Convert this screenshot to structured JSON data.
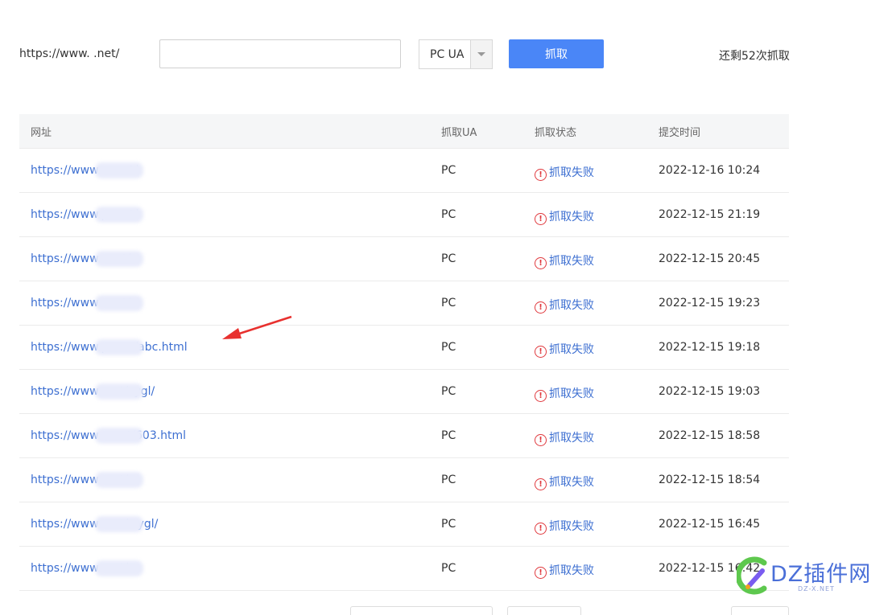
{
  "toolbar": {
    "url_prefix": "https://www.          .net/",
    "url_input_value": "",
    "ua_selected": "PC UA",
    "fetch_label": "抓取",
    "remaining_text": "还剩52次抓取"
  },
  "table": {
    "headers": {
      "url": "网址",
      "ua": "抓取UA",
      "status": "抓取状态",
      "time": "提交时间"
    },
    "rows": [
      {
        "url": "https://www.          n.net/",
        "ua": "PC",
        "status": "抓取失败",
        "time": "2022-12-16 10:24"
      },
      {
        "url": "https://www.p          .net/",
        "ua": "PC",
        "status": "抓取失败",
        "time": "2022-12-15 21:19"
      },
      {
        "url": "https://www.          .net/",
        "ua": "PC",
        "status": "抓取失败",
        "time": "2022-12-15 20:45"
      },
      {
        "url": "https://www.          .net/",
        "ua": "PC",
        "status": "抓取失败",
        "time": "2022-12-15 19:23"
      },
      {
        "url": "https://www.p          .net/abc.html",
        "ua": "PC",
        "status": "抓取失败",
        "time": "2022-12-15 19:18"
      },
      {
        "url": "https://www          .net/sygl/",
        "ua": "PC",
        "status": "抓取失败",
        "time": "2022-12-15 19:03"
      },
      {
        "url": "https://www          n.net/603.html",
        "ua": "PC",
        "status": "抓取失败",
        "time": "2022-12-15 18:58"
      },
      {
        "url": "https://www          .net/",
        "ua": "PC",
        "status": "抓取失败",
        "time": "2022-12-15 18:54"
      },
      {
        "url": "https://www          .net/wygl/",
        "ua": "PC",
        "status": "抓取失败",
        "time": "2022-12-15 16:45"
      },
      {
        "url": "https://www          .net/",
        "ua": "PC",
        "status": "抓取失败",
        "time": "2022-12-15 16:42"
      }
    ]
  },
  "status_icon": "error-circle-icon",
  "colors": {
    "accent": "#4a86f7",
    "link": "#3d6fd1",
    "error": "#e0393e",
    "annotation_arrow": "#e8312f"
  },
  "watermark": {
    "text": "DZ插件网",
    "sub": "DZ-X.NET"
  }
}
